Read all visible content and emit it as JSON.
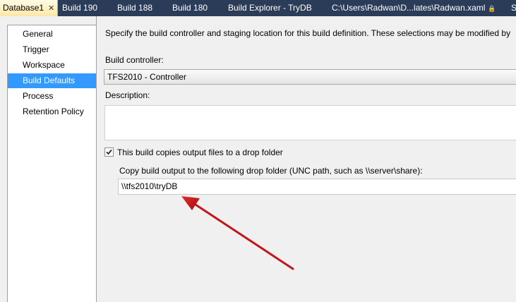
{
  "tabs": [
    {
      "label": "Database1",
      "active": true,
      "closable": true
    },
    {
      "label": "Build 190"
    },
    {
      "label": "Build 188"
    },
    {
      "label": "Build 180"
    },
    {
      "label": "Build Explorer - TryDB"
    },
    {
      "label": "C:\\Users\\Radwan\\D...lates\\Radwan.xaml",
      "pinned": true
    },
    {
      "label": "S"
    }
  ],
  "sidebar": {
    "items": [
      {
        "label": "General"
      },
      {
        "label": "Trigger"
      },
      {
        "label": "Workspace"
      },
      {
        "label": "Build Defaults",
        "selected": true
      },
      {
        "label": "Process"
      },
      {
        "label": "Retention Policy"
      }
    ]
  },
  "main": {
    "intro": "Specify the build controller and staging location for this build definition. These selections may be modified by",
    "build_controller_label": "Build controller:",
    "build_controller_value": "TFS2010 - Controller",
    "description_label": "Description:",
    "description_value": "",
    "copy_checkbox_label": "This build copies output files to a drop folder",
    "copy_checkbox_checked": true,
    "drop_folder_label": "Copy build output to the following drop folder (UNC path, such as \\\\server\\share):",
    "drop_folder_value": "\\\\tfs2010\\tryDB"
  },
  "colors": {
    "tabstrip": "#2b3c59",
    "active_tab": "#ffe8a6",
    "selection": "#3399ff",
    "annotation_arrow": "#c0171a"
  },
  "icons": {
    "tab_close": "close-icon",
    "tab_pin": "lock-icon",
    "checkbox": "checkmark-icon"
  }
}
